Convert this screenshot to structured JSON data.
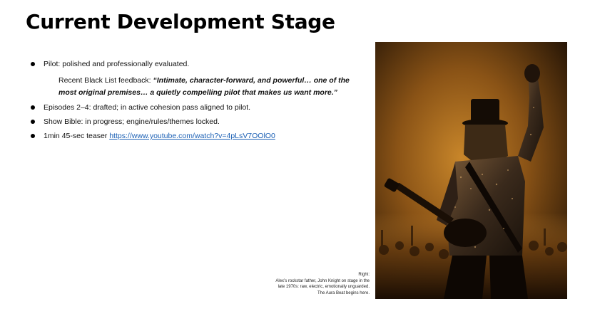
{
  "slide": {
    "title": "Current Development Stage",
    "bullets": {
      "pilot": "Pilot: polished and professionally evaluated.",
      "feedback_prefix": "Recent Black List feedback: ",
      "feedback_line1": "“Intimate, character-forward, and powerful… one of the",
      "feedback_line2": "most original premises… a quietly compelling pilot that makes us want more.”",
      "episodes": "Episodes 2–4: drafted; in active cohesion pass aligned to pilot.",
      "bible": "Show Bible: in progress; engine/rules/themes locked.",
      "teaser_prefix": "1min 45-sec teaser ",
      "teaser_link": "https://www.youtube.com/watch?v=4pLsV7OOlO0"
    },
    "caption": {
      "line1": "Right:",
      "line2": "Alex’s rockstar father, John Knight on stage in the",
      "line3": "late 1970s:  raw, electric, emotionally unguarded.",
      "line4": "The Aura Beat begins here."
    }
  },
  "colors": {
    "link": "#1a5fb4",
    "photo_glow": "#c8862a",
    "photo_dark": "#1c0f04"
  }
}
